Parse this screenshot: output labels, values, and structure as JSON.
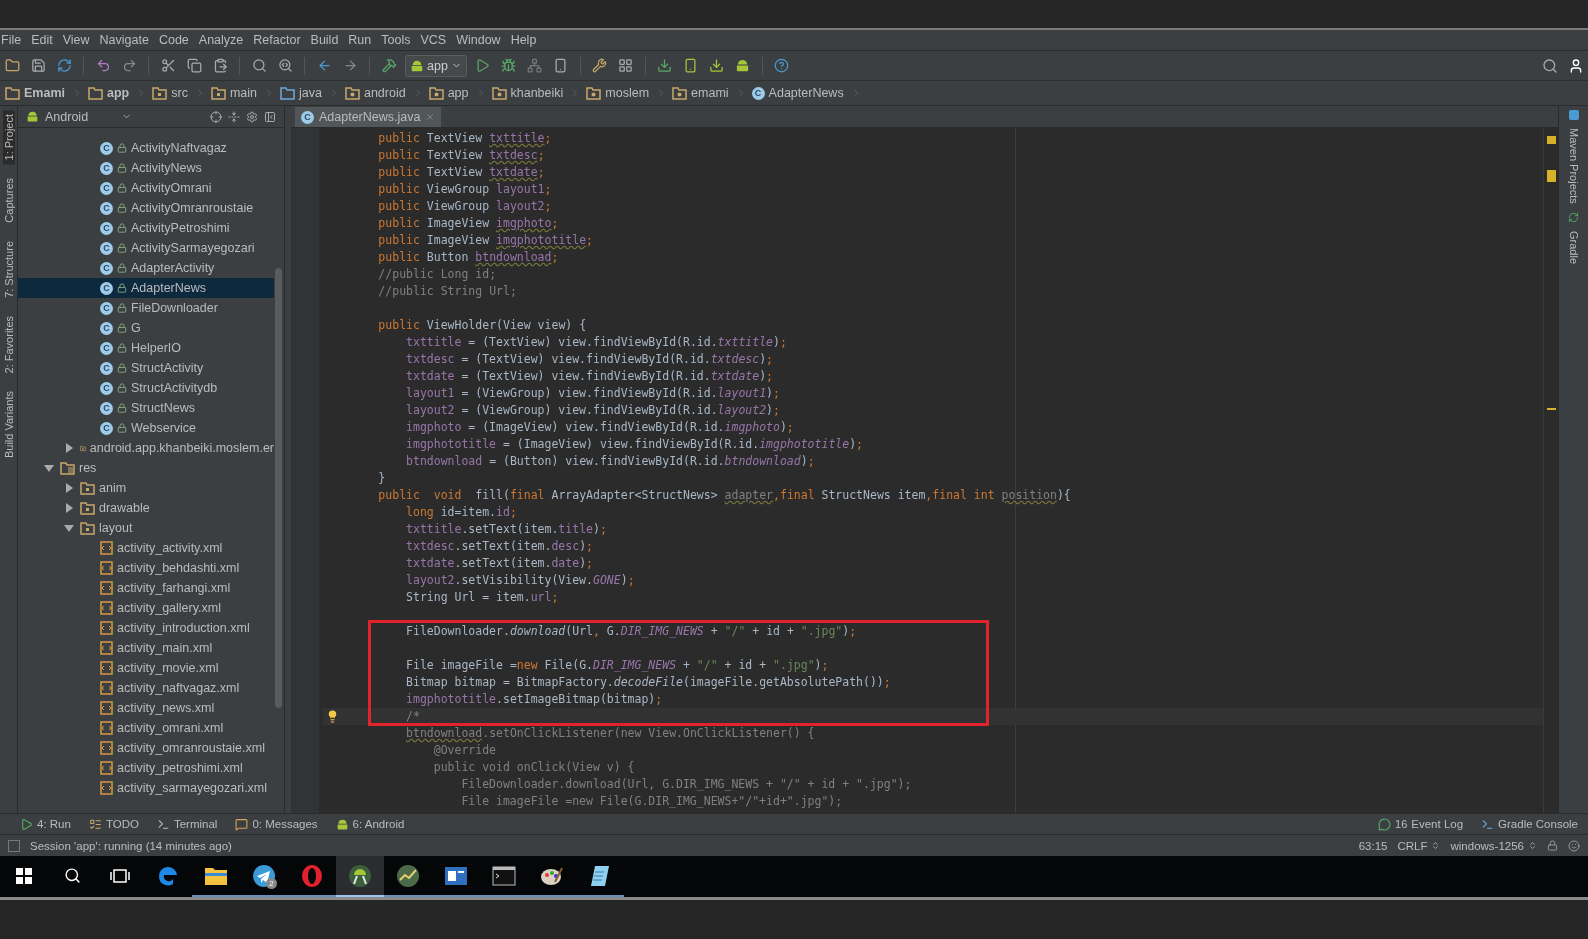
{
  "menu": [
    "File",
    "Edit",
    "View",
    "Navigate",
    "Code",
    "Analyze",
    "Refactor",
    "Build",
    "Run",
    "Tools",
    "VCS",
    "Window",
    "Help"
  ],
  "toolbar": {
    "run_config": "app"
  },
  "breadcrumbs": [
    {
      "label": "Emami",
      "kind": "module"
    },
    {
      "label": "app",
      "kind": "module"
    },
    {
      "label": "src",
      "kind": "folder"
    },
    {
      "label": "main",
      "kind": "folder"
    },
    {
      "label": "java",
      "kind": "source"
    },
    {
      "label": "android",
      "kind": "package"
    },
    {
      "label": "app",
      "kind": "package"
    },
    {
      "label": "khanbeiki",
      "kind": "package"
    },
    {
      "label": "moslem",
      "kind": "package"
    },
    {
      "label": "emami",
      "kind": "package"
    },
    {
      "label": "AdapterNews",
      "kind": "class",
      "badge": "C"
    }
  ],
  "left_strip": [
    {
      "label": "1: Project",
      "selected": true
    },
    {
      "label": "Captures",
      "selected": false
    },
    {
      "label": "7: Structure",
      "selected": false
    },
    {
      "label": "2: Favorites",
      "selected": false
    },
    {
      "label": "Build Variants",
      "selected": false
    }
  ],
  "project": {
    "view": "Android",
    "tree": [
      {
        "children": [
          {
            "children": [
              {
                "label": "ActivityNaftvagaz",
                "kind": "class",
                "badge": "C",
                "selected": false
              },
              {
                "label": "ActivityNews",
                "kind": "class",
                "badge": "C",
                "selected": false
              },
              {
                "label": "ActivityOmrani",
                "kind": "class",
                "badge": "C",
                "selected": false
              },
              {
                "label": "ActivityOmranroustaie",
                "kind": "class",
                "badge": "C",
                "selected": false
              },
              {
                "label": "ActivityPetroshimi",
                "kind": "class",
                "badge": "C",
                "selected": false
              },
              {
                "label": "ActivitySarmayegozari",
                "kind": "class",
                "badge": "C",
                "selected": false
              },
              {
                "label": "AdapterActivity",
                "kind": "class",
                "badge": "C",
                "selected": false
              },
              {
                "label": "AdapterNews",
                "kind": "class",
                "badge": "C",
                "selected": true
              },
              {
                "label": "FileDownloader",
                "kind": "class",
                "badge": "C",
                "selected": false
              },
              {
                "label": "G",
                "kind": "class",
                "badge": "C",
                "selected": false
              },
              {
                "label": "HelperIO",
                "kind": "class",
                "badge": "C",
                "selected": false
              },
              {
                "label": "StructActivity",
                "kind": "class",
                "badge": "C",
                "selected": false
              },
              {
                "label": "StructActivitydb",
                "kind": "class",
                "badge": "C",
                "selected": false
              },
              {
                "label": "StructNews",
                "kind": "class",
                "badge": "C",
                "selected": false
              },
              {
                "label": "Webservice",
                "kind": "class",
                "badge": "C",
                "selected": false
              }
            ]
          },
          {
            "label": "android.app.khanbeiki.moslem.er",
            "kind": "package",
            "expanded": false,
            "selected": false
          }
        ]
      },
      {
        "label": "res",
        "kind": "res",
        "expanded": true,
        "selected": false,
        "children": [
          {
            "label": "anim",
            "kind": "folder",
            "expanded": false,
            "selected": false
          },
          {
            "label": "drawable",
            "kind": "folder",
            "expanded": false,
            "selected": false
          },
          {
            "label": "layout",
            "kind": "folder",
            "expanded": true,
            "selected": false,
            "children": [
              {
                "label": "activity_activity.xml",
                "kind": "xml",
                "selected": false
              },
              {
                "label": "activity_behdashti.xml",
                "kind": "xml",
                "selected": false
              },
              {
                "label": "activity_farhangi.xml",
                "kind": "xml",
                "selected": false
              },
              {
                "label": "activity_gallery.xml",
                "kind": "xml",
                "selected": false
              },
              {
                "label": "activity_introduction.xml",
                "kind": "xml",
                "selected": false
              },
              {
                "label": "activity_main.xml",
                "kind": "xml",
                "selected": false
              },
              {
                "label": "activity_movie.xml",
                "kind": "xml",
                "selected": false
              },
              {
                "label": "activity_naftvagaz.xml",
                "kind": "xml",
                "selected": false
              },
              {
                "label": "activity_news.xml",
                "kind": "xml",
                "selected": false
              },
              {
                "label": "activity_omrani.xml",
                "kind": "xml",
                "selected": false
              },
              {
                "label": "activity_omranroustaie.xml",
                "kind": "xml",
                "selected": false
              },
              {
                "label": "activity_petroshimi.xml",
                "kind": "xml",
                "selected": false
              },
              {
                "label": "activity_sarmayegozari.xml",
                "kind": "xml",
                "selected": false
              }
            ]
          }
        ]
      }
    ]
  },
  "editor": {
    "tabs": [
      {
        "label": "AdapterNews.java",
        "badge": "C",
        "selected": true
      }
    ],
    "blocks": [
      {
        "boxed": false,
        "lines": [
          {
            "current": false,
            "tokens": [
              {
                "kind": "kw",
                "text": "        public"
              },
              {
                "kind": "id",
                "text": " TextView "
              },
              {
                "kind": "fieldw",
                "text": "txttitle"
              },
              {
                "kind": "kw",
                "text": ";"
              }
            ]
          },
          {
            "current": false,
            "tokens": [
              {
                "kind": "kw",
                "text": "        public"
              },
              {
                "kind": "id",
                "text": " TextView "
              },
              {
                "kind": "fieldw",
                "text": "txtdesc"
              },
              {
                "kind": "kw",
                "text": ";"
              }
            ]
          },
          {
            "current": false,
            "tokens": [
              {
                "kind": "kw",
                "text": "        public"
              },
              {
                "kind": "id",
                "text": " TextView "
              },
              {
                "kind": "fieldw",
                "text": "txtdate"
              },
              {
                "kind": "kw",
                "text": ";"
              }
            ]
          },
          {
            "current": false,
            "tokens": [
              {
                "kind": "kw",
                "text": "        public"
              },
              {
                "kind": "id",
                "text": " ViewGroup "
              },
              {
                "kind": "field",
                "text": "layout1"
              },
              {
                "kind": "kw",
                "text": ";"
              }
            ]
          },
          {
            "current": false,
            "tokens": [
              {
                "kind": "kw",
                "text": "        public"
              },
              {
                "kind": "id",
                "text": " ViewGroup "
              },
              {
                "kind": "field",
                "text": "layout2"
              },
              {
                "kind": "kw",
                "text": ";"
              }
            ]
          },
          {
            "current": false,
            "tokens": [
              {
                "kind": "kw",
                "text": "        public"
              },
              {
                "kind": "id",
                "text": " ImageView "
              },
              {
                "kind": "fieldw",
                "text": "imgphoto"
              },
              {
                "kind": "kw",
                "text": ";"
              }
            ]
          },
          {
            "current": false,
            "tokens": [
              {
                "kind": "kw",
                "text": "        public"
              },
              {
                "kind": "id",
                "text": " ImageView "
              },
              {
                "kind": "fieldw",
                "text": "imgphototitle"
              },
              {
                "kind": "kw",
                "text": ";"
              }
            ]
          },
          {
            "current": false,
            "tokens": [
              {
                "kind": "kw",
                "text": "        public"
              },
              {
                "kind": "id",
                "text": " Button "
              },
              {
                "kind": "fieldw",
                "text": "btndownload"
              },
              {
                "kind": "kw",
                "text": ";"
              }
            ]
          },
          {
            "current": false,
            "tokens": [
              {
                "kind": "cmt",
                "text": "        //public Long id;"
              }
            ]
          },
          {
            "current": false,
            "tokens": [
              {
                "kind": "cmt",
                "text": "        //public String Url;"
              }
            ]
          },
          {
            "current": false
          },
          {
            "current": false,
            "tokens": [
              {
                "kind": "kw",
                "text": "        public"
              },
              {
                "kind": "id",
                "text": " ViewHolder(View view) {"
              }
            ]
          },
          {
            "current": false,
            "tokens": [
              {
                "kind": "field",
                "text": "            txttitle"
              },
              {
                "kind": "id",
                "text": " = (TextView) view.findViewById(R.id."
              },
              {
                "kind": "sfield",
                "text": "txttitle"
              },
              {
                "kind": "id",
                "text": ")"
              },
              {
                "kind": "kw",
                "text": ";"
              }
            ]
          },
          {
            "current": false,
            "tokens": [
              {
                "kind": "field",
                "text": "            txtdesc"
              },
              {
                "kind": "id",
                "text": " = (TextView) view.findViewById(R.id."
              },
              {
                "kind": "sfield",
                "text": "txtdesc"
              },
              {
                "kind": "id",
                "text": ")"
              },
              {
                "kind": "kw",
                "text": ";"
              }
            ]
          },
          {
            "current": false,
            "tokens": [
              {
                "kind": "field",
                "text": "            txtdate"
              },
              {
                "kind": "id",
                "text": " = (TextView) view.findViewById(R.id."
              },
              {
                "kind": "sfield",
                "text": "txtdate"
              },
              {
                "kind": "id",
                "text": ")"
              },
              {
                "kind": "kw",
                "text": ";"
              }
            ]
          },
          {
            "current": false,
            "tokens": [
              {
                "kind": "field",
                "text": "            layout1"
              },
              {
                "kind": "id",
                "text": " = (ViewGroup) view.findViewById(R.id."
              },
              {
                "kind": "sfield",
                "text": "layout1"
              },
              {
                "kind": "id",
                "text": ")"
              },
              {
                "kind": "kw",
                "text": ";"
              }
            ]
          },
          {
            "current": false,
            "tokens": [
              {
                "kind": "field",
                "text": "            layout2"
              },
              {
                "kind": "id",
                "text": " = (ViewGroup) view.findViewById(R.id."
              },
              {
                "kind": "sfield",
                "text": "layout2"
              },
              {
                "kind": "id",
                "text": ")"
              },
              {
                "kind": "kw",
                "text": ";"
              }
            ]
          },
          {
            "current": false,
            "tokens": [
              {
                "kind": "field",
                "text": "            imgphoto"
              },
              {
                "kind": "id",
                "text": " = (ImageView) view.findViewById(R.id."
              },
              {
                "kind": "sfield",
                "text": "imgphoto"
              },
              {
                "kind": "id",
                "text": ")"
              },
              {
                "kind": "kw",
                "text": ";"
              }
            ]
          },
          {
            "current": false,
            "tokens": [
              {
                "kind": "field",
                "text": "            imgphototitle"
              },
              {
                "kind": "id",
                "text": " = (ImageView) view.findViewById(R.id."
              },
              {
                "kind": "sfield",
                "text": "imgphototitle"
              },
              {
                "kind": "id",
                "text": ")"
              },
              {
                "kind": "kw",
                "text": ";"
              }
            ]
          },
          {
            "current": false,
            "tokens": [
              {
                "kind": "field",
                "text": "            btndownload"
              },
              {
                "kind": "id",
                "text": " = (Button) view.findViewById(R.id."
              },
              {
                "kind": "sfield",
                "text": "btndownload"
              },
              {
                "kind": "id",
                "text": ")"
              },
              {
                "kind": "kw",
                "text": ";"
              }
            ]
          },
          {
            "current": false,
            "tokens": [
              {
                "kind": "id",
                "text": "        }"
              }
            ]
          },
          {
            "current": false,
            "tokens": [
              {
                "kind": "kw",
                "text": "        public  void  "
              },
              {
                "kind": "id",
                "text": "fill("
              },
              {
                "kind": "kw",
                "text": "final "
              },
              {
                "kind": "id",
                "text": "ArrayAdapter<StructNews> "
              },
              {
                "kind": "idw",
                "text": "adapter"
              },
              {
                "kind": "kw",
                "text": ",final "
              },
              {
                "kind": "id",
                "text": "StructNews item"
              },
              {
                "kind": "kw",
                "text": ",final int "
              },
              {
                "kind": "idw",
                "text": "position"
              },
              {
                "kind": "id",
                "text": "){"
              }
            ]
          },
          {
            "current": false,
            "tokens": [
              {
                "kind": "kw",
                "text": "            long "
              },
              {
                "kind": "id",
                "text": "id=item."
              },
              {
                "kind": "field",
                "text": "id"
              },
              {
                "kind": "kw",
                "text": ";"
              }
            ]
          },
          {
            "current": false,
            "tokens": [
              {
                "kind": "field",
                "text": "            txttitle"
              },
              {
                "kind": "id",
                "text": ".setText(item."
              },
              {
                "kind": "field",
                "text": "title"
              },
              {
                "kind": "id",
                "text": ")"
              },
              {
                "kind": "kw",
                "text": ";"
              }
            ]
          },
          {
            "current": false,
            "tokens": [
              {
                "kind": "field",
                "text": "            txtdesc"
              },
              {
                "kind": "id",
                "text": ".setText(item."
              },
              {
                "kind": "field",
                "text": "desc"
              },
              {
                "kind": "id",
                "text": ")"
              },
              {
                "kind": "kw",
                "text": ";"
              }
            ]
          },
          {
            "current": false,
            "tokens": [
              {
                "kind": "field",
                "text": "            txtdate"
              },
              {
                "kind": "id",
                "text": ".setText(item."
              },
              {
                "kind": "field",
                "text": "date"
              },
              {
                "kind": "id",
                "text": ")"
              },
              {
                "kind": "kw",
                "text": ";"
              }
            ]
          },
          {
            "current": false,
            "tokens": [
              {
                "kind": "field",
                "text": "            layout2"
              },
              {
                "kind": "id",
                "text": ".setVisibility(View."
              },
              {
                "kind": "sfield",
                "text": "GONE"
              },
              {
                "kind": "id",
                "text": ")"
              },
              {
                "kind": "kw",
                "text": ";"
              }
            ]
          },
          {
            "current": false,
            "tokens": [
              {
                "kind": "id",
                "text": "            String Url = item."
              },
              {
                "kind": "field",
                "text": "url"
              },
              {
                "kind": "kw",
                "text": ";"
              }
            ]
          },
          {
            "current": false
          }
        ]
      },
      {
        "boxed": true,
        "lines": [
          {
            "current": false,
            "tokens": [
              {
                "kind": "id",
                "text": "            FileDownloader."
              },
              {
                "kind": "smethod",
                "text": "download"
              },
              {
                "kind": "id",
                "text": "(Url"
              },
              {
                "kind": "kw",
                "text": ", "
              },
              {
                "kind": "id",
                "text": "G."
              },
              {
                "kind": "sfield",
                "text": "DIR_IMG_NEWS"
              },
              {
                "kind": "id",
                "text": " + "
              },
              {
                "kind": "str",
                "text": "\"/\""
              },
              {
                "kind": "id",
                "text": " + id + "
              },
              {
                "kind": "str",
                "text": "\".jpg\""
              },
              {
                "kind": "id",
                "text": ")"
              },
              {
                "kind": "kw",
                "text": ";"
              }
            ]
          },
          {
            "current": false
          },
          {
            "current": false,
            "tokens": [
              {
                "kind": "id",
                "text": "            File imageFile ="
              },
              {
                "kind": "kw",
                "text": "new "
              },
              {
                "kind": "id",
                "text": "File(G."
              },
              {
                "kind": "sfield",
                "text": "DIR_IMG_NEWS"
              },
              {
                "kind": "id",
                "text": " + "
              },
              {
                "kind": "str",
                "text": "\"/\""
              },
              {
                "kind": "id",
                "text": " + id + "
              },
              {
                "kind": "str",
                "text": "\".jpg\""
              },
              {
                "kind": "id",
                "text": ")"
              },
              {
                "kind": "kw",
                "text": ";"
              }
            ]
          },
          {
            "current": false,
            "tokens": [
              {
                "kind": "id",
                "text": "            Bitmap bitmap = BitmapFactory."
              },
              {
                "kind": "smethod",
                "text": "decodeFile"
              },
              {
                "kind": "id",
                "text": "(imageFile.getAbsolutePath())"
              },
              {
                "kind": "kw",
                "text": ";"
              }
            ]
          },
          {
            "current": false,
            "tokens": [
              {
                "kind": "field",
                "text": "            imgphototitle"
              },
              {
                "kind": "id",
                "text": ".setImageBitmap(bitmap)"
              },
              {
                "kind": "kw",
                "text": ";"
              }
            ]
          },
          {
            "current": true,
            "tokens": [
              {
                "kind": "cmt",
                "text": "            /*"
              }
            ]
          }
        ]
      },
      {
        "boxed": false,
        "lines": [
          {
            "current": false,
            "tokens": [
              {
                "kind": "cmtw",
                "text": "            btndownload"
              },
              {
                "kind": "cmt",
                "text": ".setOnClickListener(new View.OnClickListener() {"
              }
            ]
          },
          {
            "current": false,
            "tokens": [
              {
                "kind": "cmt",
                "text": "                @Override"
              }
            ]
          },
          {
            "current": false,
            "tokens": [
              {
                "kind": "cmt",
                "text": "                public void onClick(View v) {"
              }
            ]
          },
          {
            "current": false,
            "tokens": [
              {
                "kind": "cmt",
                "text": "                    FileDownloader.download(Url, G.DIR_IMG_NEWS + \"/\" + id + \".jpg\");"
              }
            ]
          },
          {
            "current": false,
            "tokens": [
              {
                "kind": "cmt",
                "text": "                    File imageFile =new File(G.DIR_IMG_NEWS+\"/\"+id+\".jpg\");"
              }
            ]
          }
        ]
      }
    ]
  },
  "right_strip": [
    "Maven Projects",
    "Gradle"
  ],
  "tool_windows": {
    "left": [
      {
        "label": "4: Run",
        "kind": "run"
      },
      {
        "label": "TODO",
        "kind": "todo"
      },
      {
        "label": "Terminal",
        "kind": "terminal"
      },
      {
        "label": "0: Messages",
        "kind": "messages"
      },
      {
        "label": "6: Android",
        "kind": "android"
      }
    ],
    "right": [
      {
        "label": "Event Log",
        "kind": "log",
        "count": "16"
      },
      {
        "label": "Gradle Console",
        "kind": "console"
      }
    ]
  },
  "status_bar": {
    "message": "Session 'app': running (14 minutes ago)",
    "position": "63:15",
    "line_separator": "CRLF",
    "encoding": "windows-1256"
  },
  "taskbar": {
    "apps": [
      {
        "kind": "edge",
        "running": false,
        "selected": false
      },
      {
        "kind": "explorer",
        "running": true,
        "selected": false
      },
      {
        "kind": "telegram",
        "running": true,
        "selected": false,
        "badge": "2"
      },
      {
        "kind": "opera",
        "running": true,
        "selected": false
      },
      {
        "kind": "android-studio",
        "running": true,
        "selected": true
      },
      {
        "kind": "chart",
        "running": true,
        "selected": false
      },
      {
        "kind": "window",
        "running": true,
        "selected": false
      },
      {
        "kind": "terminal",
        "running": true,
        "selected": false
      },
      {
        "kind": "paint",
        "running": true,
        "selected": false
      },
      {
        "kind": "notepad",
        "running": true,
        "selected": false
      }
    ]
  }
}
